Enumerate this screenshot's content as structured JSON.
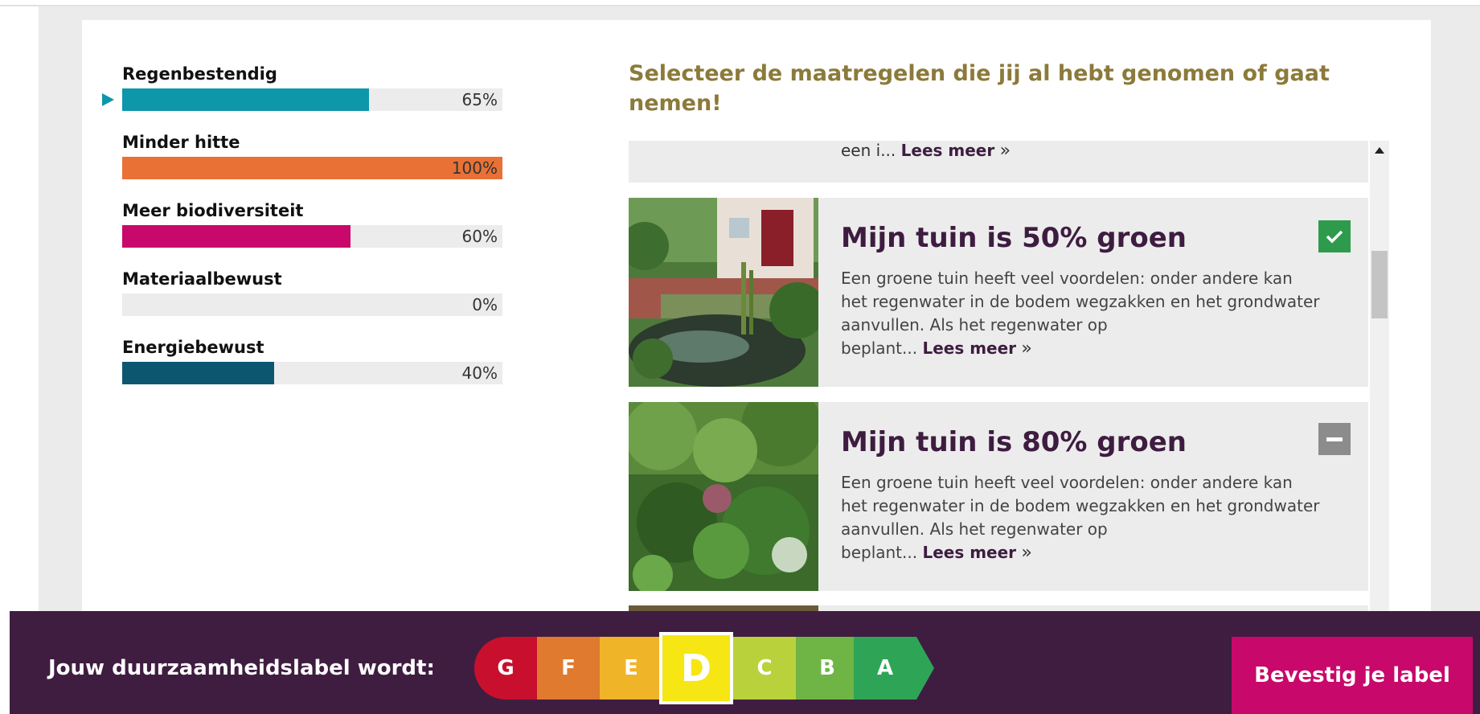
{
  "progress": {
    "items": [
      {
        "label": "Regenbestendig",
        "percent": 65,
        "percent_text": "65%",
        "color": "#0e96aa"
      },
      {
        "label": "Minder hitte",
        "percent": 100,
        "percent_text": "100%",
        "color": "#e97135"
      },
      {
        "label": "Meer biodiversiteit",
        "percent": 60,
        "percent_text": "60%",
        "color": "#c8086a"
      },
      {
        "label": "Materiaalbewust",
        "percent": 0,
        "percent_text": "0%",
        "color": "#888888"
      },
      {
        "label": "Energiebewust",
        "percent": 40,
        "percent_text": "40%",
        "color": "#0c5670"
      }
    ]
  },
  "main": {
    "heading": "Selecteer de maatregelen die jij al hebt genomen of gaat nemen!",
    "partial_item": {
      "text": "een i...",
      "more": "Lees meer",
      "arrow": "»"
    },
    "items": [
      {
        "title": "Mijn tuin is 50% groen",
        "desc": "Een groene tuin heeft veel voordelen: onder andere kan het regenwater in de bodem wegzakken en het grondwater aanvullen. Als het regenwater op",
        "desc_tail": "beplant...",
        "more": "Lees meer",
        "arrow": "»",
        "state": "checked"
      },
      {
        "title": "Mijn tuin is 80% groen",
        "desc": "Een groene tuin heeft veel voordelen: onder andere kan het regenwater in de bodem wegzakken en het grondwater aanvullen. Als het regenwater op",
        "desc_tail": "beplant...",
        "more": "Lees meer",
        "arrow": "»",
        "state": "unchecked"
      }
    ]
  },
  "footer": {
    "label": "Jouw duurzaamheidslabel wordt:",
    "energy_labels": [
      {
        "letter": "G",
        "color": "#c8102e"
      },
      {
        "letter": "F",
        "color": "#e07a2f"
      },
      {
        "letter": "E",
        "color": "#f0b429"
      },
      {
        "letter": "D",
        "color": "#f5e614"
      },
      {
        "letter": "C",
        "color": "#b9d23b"
      },
      {
        "letter": "B",
        "color": "#6fb545"
      },
      {
        "letter": "A",
        "color": "#2ea556"
      }
    ],
    "selected": "D",
    "confirm": "Bevestig je label"
  }
}
